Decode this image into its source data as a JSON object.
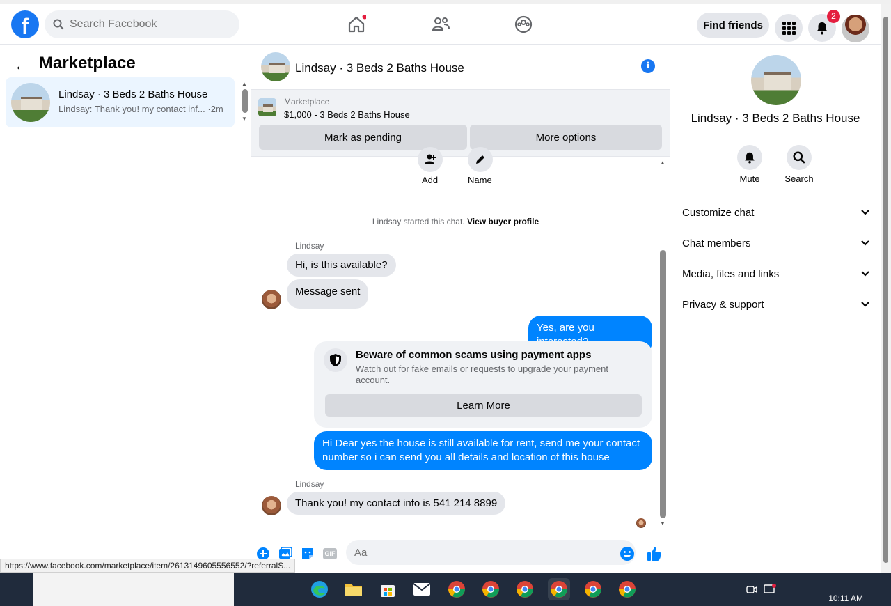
{
  "topbar": {
    "logo": "f",
    "search_placeholder": "Search Facebook",
    "find_friends": "Find friends",
    "notification_count": "2",
    "icons": [
      "home-icon",
      "friends-icon",
      "groups-icon",
      "menu-grid-icon",
      "bell-icon"
    ]
  },
  "left": {
    "title": "Marketplace",
    "conversation": {
      "title": "Lindsay · 3 Beds 2 Baths House",
      "preview": "Lindsay: Thank you! my contact inf... ·2m"
    }
  },
  "chat": {
    "header_title": "Lindsay · 3 Beds 2 Baths House",
    "listing_source": "Marketplace",
    "listing_price": "$1,000 - 3 Beds 2 Baths House",
    "mark_pending": "Mark as pending",
    "more_options": "More options",
    "add_label": "Add",
    "name_label": "Name",
    "system_prefix": "Lindsay started this chat.",
    "system_link": "View buyer profile",
    "sender": "Lindsay",
    "msg1": "Hi, is this available?",
    "msg2": "Message sent",
    "msg3": "Yes, are you interested?",
    "warning_title": "Beware of common scams using payment apps",
    "warning_text": "Watch out for fake emails or requests to upgrade your payment account.",
    "learn_more": "Learn More",
    "msg4": "Hi Dear yes the house is still available for rent, send me your contact number so i can send you all details and location of this house",
    "sender2": "Lindsay",
    "msg5": "Thank you! my contact info is 541 214 8899",
    "composer_placeholder": "Aa",
    "gif_label": "GIF"
  },
  "right": {
    "title": "Lindsay · 3 Beds 2 Baths House",
    "mute": "Mute",
    "search": "Search",
    "sections": [
      "Customize chat",
      "Chat members",
      "Media, files and links",
      "Privacy & support"
    ]
  },
  "status_url": "https://www.facebook.com/marketplace/item/2613149605556552/?referralS...",
  "taskbar": {
    "time": "10:11 AM"
  },
  "colors": {
    "brand": "#1877f2",
    "outgoing_bubble": "#0084ff",
    "badge": "#e41e3f"
  }
}
